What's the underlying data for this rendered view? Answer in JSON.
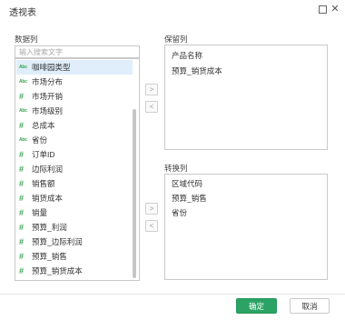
{
  "dialog": {
    "title": "透视表"
  },
  "left": {
    "label": "数据列",
    "search_placeholder": "输入搜索文字",
    "items": [
      {
        "label": "咖啡园类型",
        "type": "text",
        "icon": "abc-icon",
        "selected": true
      },
      {
        "label": "市场分布",
        "type": "text",
        "icon": "abc-icon",
        "selected": false
      },
      {
        "label": "市场开销",
        "type": "number",
        "icon": "hash-icon",
        "selected": false
      },
      {
        "label": "市场级别",
        "type": "text",
        "icon": "abc-icon",
        "selected": false
      },
      {
        "label": "总成本",
        "type": "number",
        "icon": "hash-icon",
        "selected": false
      },
      {
        "label": "省份",
        "type": "text",
        "icon": "abc-icon",
        "selected": false
      },
      {
        "label": "订单ID",
        "type": "number",
        "icon": "hash-icon",
        "selected": false
      },
      {
        "label": "边际利润",
        "type": "number",
        "icon": "hash-icon",
        "selected": false
      },
      {
        "label": "销售额",
        "type": "number",
        "icon": "hash-icon",
        "selected": false
      },
      {
        "label": "销货成本",
        "type": "number",
        "icon": "hash-icon",
        "selected": false
      },
      {
        "label": "销量",
        "type": "number",
        "icon": "hash-icon",
        "selected": false
      },
      {
        "label": "预算_利润",
        "type": "number",
        "icon": "hash-icon",
        "selected": false
      },
      {
        "label": "预算_边际利润",
        "type": "number",
        "icon": "hash-icon",
        "selected": false
      },
      {
        "label": "预算_销售",
        "type": "number",
        "icon": "hash-icon",
        "selected": false
      },
      {
        "label": "预算_销货成本",
        "type": "number",
        "icon": "hash-icon",
        "selected": false
      }
    ]
  },
  "move_buttons": {
    "right": ">",
    "left": "<"
  },
  "keep": {
    "label": "保留列",
    "items": [
      "产品名称",
      "预算_销货成本"
    ]
  },
  "transpose": {
    "label": "转换列",
    "items": [
      "区域代码",
      "预算_销售",
      "省份"
    ]
  },
  "footer": {
    "ok_label": "确定",
    "cancel_label": "取消"
  },
  "colors": {
    "primary": "#2aa364",
    "selected_row": "#dfeefa",
    "icon": "#3aa556"
  }
}
